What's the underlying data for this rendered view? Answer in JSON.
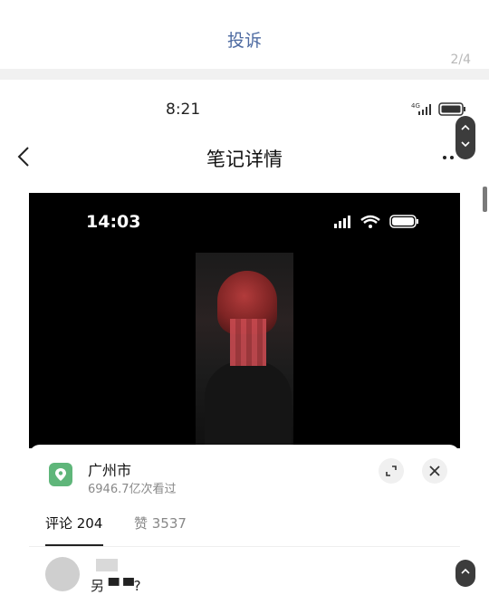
{
  "complain_bar": {
    "label": "投诉",
    "pager": "2/4"
  },
  "status_bar": {
    "time": "8:21",
    "network": "4G"
  },
  "nav": {
    "title": "笔记详情"
  },
  "video": {
    "overlay_time": "14:03"
  },
  "location_card": {
    "city": "广州市",
    "views": "6946.7亿次看过"
  },
  "tabs": [
    {
      "label": "评论 204"
    },
    {
      "label": "赞 3537"
    }
  ],
  "comment": {
    "name": "另 ▀ ▀?"
  },
  "colors": {
    "accent_link": "#4d6aa1",
    "pin_green": "#5fb67a",
    "video_bg": "#000000"
  }
}
